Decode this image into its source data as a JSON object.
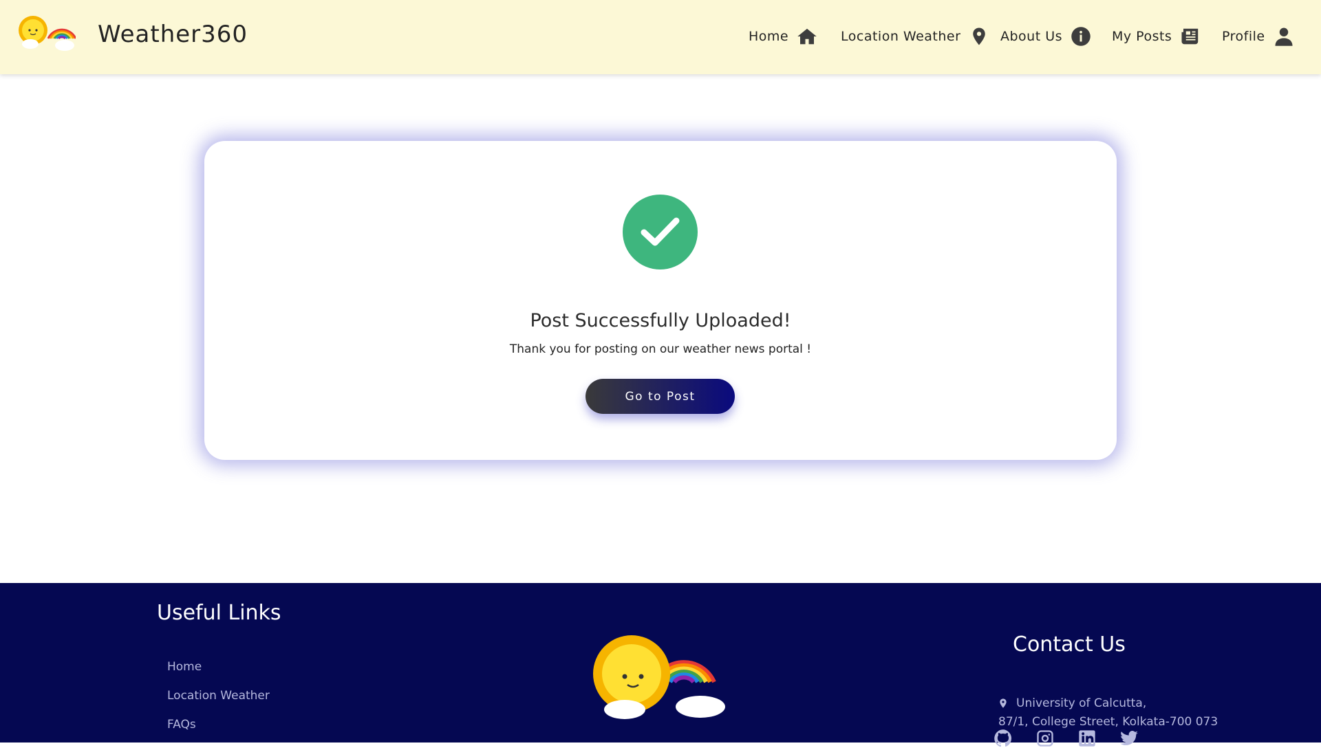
{
  "navbar": {
    "brand": "Weather360",
    "items": [
      {
        "label": "Home",
        "icon": "home-icon"
      },
      {
        "label": "Location Weather",
        "icon": "location-pin-icon"
      },
      {
        "label": "About Us",
        "icon": "info-icon"
      },
      {
        "label": "My Posts",
        "icon": "newspaper-icon"
      },
      {
        "label": "Profile",
        "icon": "user-icon"
      }
    ]
  },
  "card": {
    "icon": "check-circle-icon",
    "title": "Post Successfully Uploaded!",
    "message": "Thank you for posting on our weather news portal !",
    "button_label": "Go to Post"
  },
  "footer": {
    "links_heading": "Useful Links",
    "links": [
      "Home",
      "Location Weather",
      "FAQs"
    ],
    "contact_heading": "Contact Us",
    "address_line1": "University of Calcutta,",
    "address_line2": "87/1, College Street, Kolkata-700 073",
    "social_icons": [
      "github-icon",
      "instagram-icon",
      "linkedin-icon",
      "twitter-icon"
    ]
  },
  "colors": {
    "navbar_bg": "#fcf8d6",
    "footer_bg": "#050852",
    "success_green": "#3eb67e",
    "button_gradient_start": "#3a3a3a",
    "button_gradient_end": "#0a0a7e",
    "card_glow": "#5f5fd2"
  }
}
